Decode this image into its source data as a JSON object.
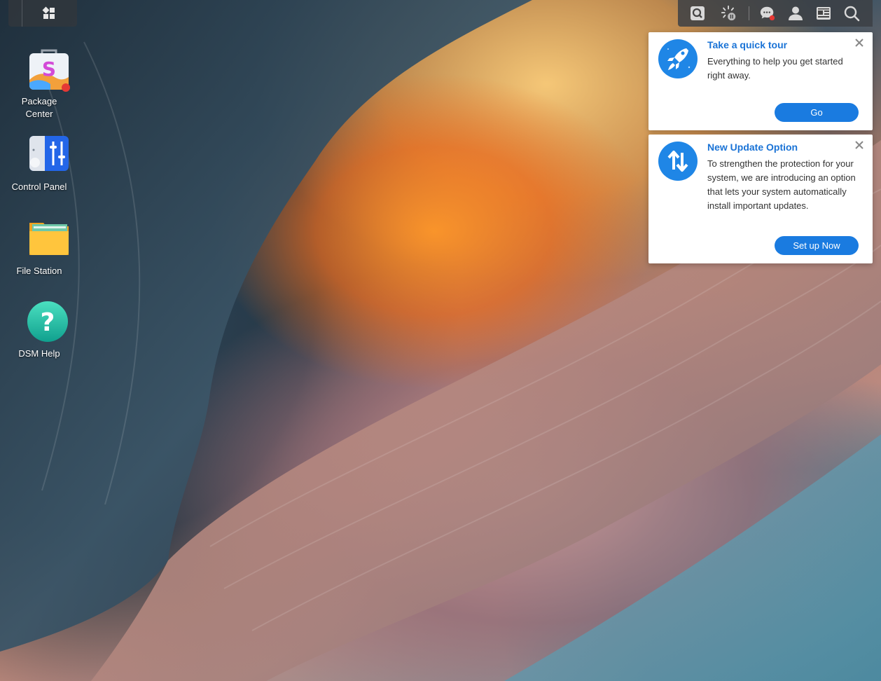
{
  "taskbar": {
    "main_menu_icon": "grid-icon",
    "right_icons": [
      "search-window-icon",
      "task-progress-icon",
      "notifications-icon",
      "user-icon",
      "widgets-icon",
      "search-icon"
    ]
  },
  "desktop": {
    "items": [
      {
        "label": "Package\nCenter",
        "icon": "package-center-icon"
      },
      {
        "label": "Control Panel",
        "icon": "control-panel-icon"
      },
      {
        "label": "File Station",
        "icon": "file-station-icon"
      },
      {
        "label": "DSM Help",
        "icon": "dsm-help-icon"
      }
    ]
  },
  "notifications": [
    {
      "title": "Take a quick tour",
      "body": "Everything to help you get started right away.",
      "button": "Go",
      "icon": "rocket-icon"
    },
    {
      "title": "New Update Option",
      "body": "To strengthen the protection for your system, we are introducing an option that lets your system automatically install important updates.",
      "button": "Set up Now",
      "icon": "update-arrows-icon"
    }
  ],
  "colors": {
    "accent": "#1a7be0",
    "title_blue": "#1a73d6",
    "badge_red": "#e53935"
  }
}
